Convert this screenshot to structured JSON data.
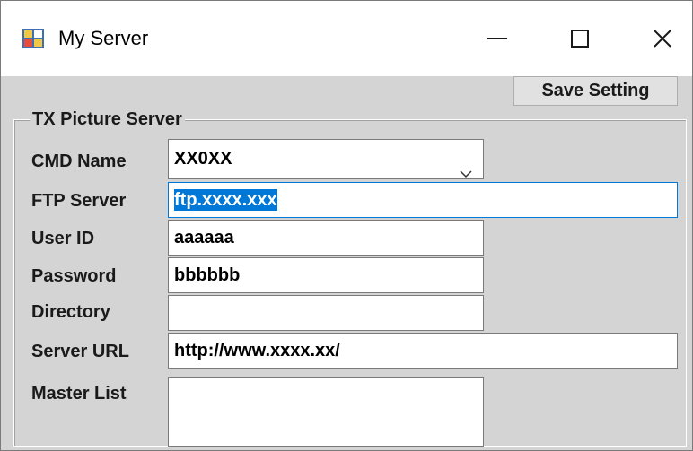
{
  "window": {
    "title": "My Server",
    "icon": "app-window-icon",
    "controls": [
      "minimize-icon",
      "maximize-icon",
      "close-icon"
    ]
  },
  "toolbar": {
    "save_label": "Save Setting"
  },
  "group": {
    "title": "TX Picture Server"
  },
  "form": {
    "cmd_name": {
      "label": "CMD Name",
      "value": "XX0XX"
    },
    "ftp_server": {
      "label": "FTP Server",
      "value": "ftp.xxxx.xxx"
    },
    "user_id": {
      "label": "User ID",
      "value": "aaaaaa"
    },
    "password": {
      "label": "Password",
      "value": "bbbbbb"
    },
    "directory": {
      "label": "Directory",
      "value": ""
    },
    "server_url": {
      "label": "Server URL",
      "value": "http://www.xxxx.xx/"
    },
    "master_list": {
      "label": "Master List",
      "value": ""
    }
  },
  "colors": {
    "selection": "#0078d7",
    "client_bg": "#d4d4d4",
    "titlebar_bg": "#ffffff"
  }
}
